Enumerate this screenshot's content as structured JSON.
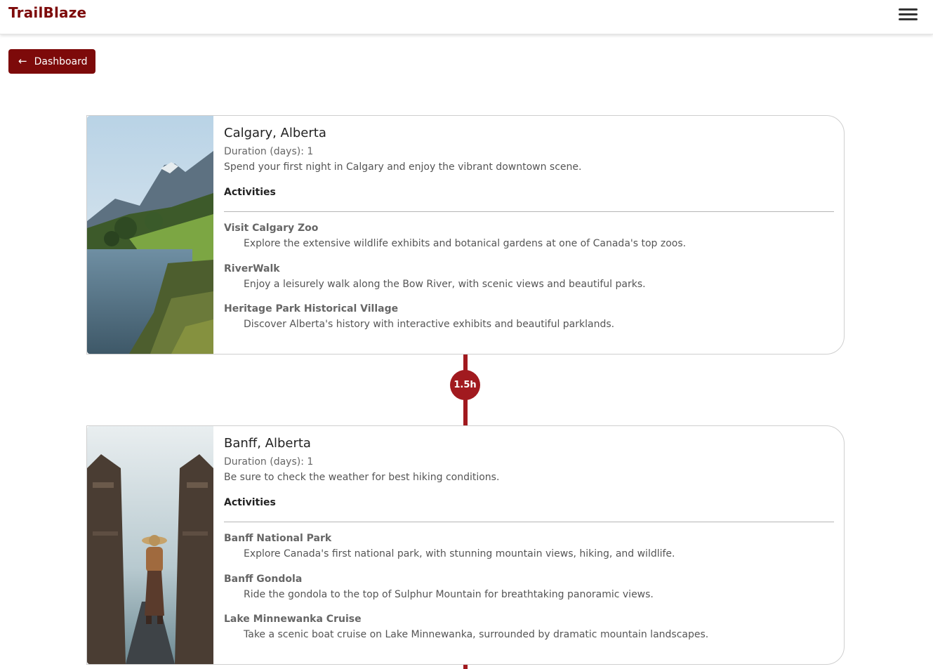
{
  "navbar": {
    "brand": "TrailBlaze",
    "menu_icon": "hamburger-menu-icon"
  },
  "back_button": {
    "label": "Dashboard",
    "icon": "arrow-left-icon"
  },
  "colors": {
    "brand": "#7d0a0a",
    "timeline": "#a11a1f"
  },
  "stops": [
    {
      "title": "Calgary, Alberta",
      "duration": "Duration (days): 1",
      "description": "Spend your first night in Calgary and enjoy the vibrant downtown scene.",
      "activities_heading": "Activities",
      "activities": [
        {
          "name": "Visit Calgary Zoo",
          "description": "Explore the extensive wildlife exhibits and botanical gardens at one of Canada's top zoos."
        },
        {
          "name": "RiverWalk",
          "description": "Enjoy a leisurely walk along the Bow River, with scenic views and beautiful parks."
        },
        {
          "name": "Heritage Park Historical Village",
          "description": "Discover Alberta's history with interactive exhibits and beautiful parklands."
        }
      ]
    },
    {
      "title": "Banff, Alberta",
      "duration": "Duration (days): 1",
      "description": "Be sure to check the weather for best hiking conditions.",
      "activities_heading": "Activities",
      "activities": [
        {
          "name": "Banff National Park",
          "description": "Explore Canada's first national park, with stunning mountain views, hiking, and wildlife."
        },
        {
          "name": "Banff Gondola",
          "description": "Ride the gondola to the top of Sulphur Mountain for breathtaking panoramic views."
        },
        {
          "name": "Lake Minnewanka Cruise",
          "description": "Take a scenic boat cruise on Lake Minnewanka, surrounded by dramatic mountain landscapes."
        }
      ]
    }
  ],
  "travel_segments": [
    {
      "label": "1.5h"
    }
  ]
}
